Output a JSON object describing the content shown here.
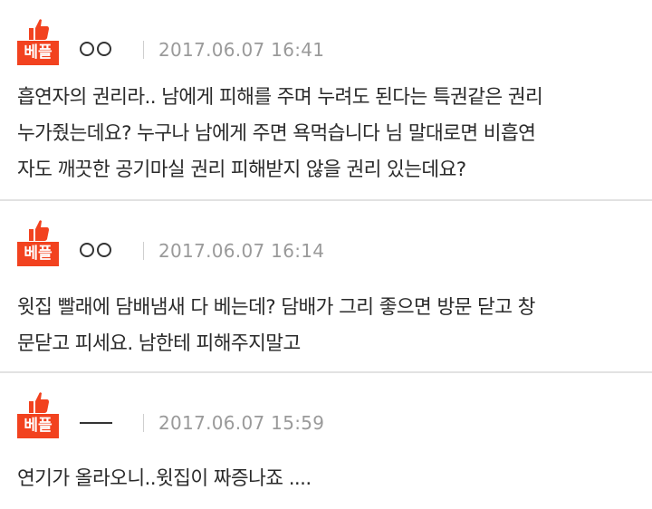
{
  "colors": {
    "badge": "#f2421f",
    "date": "#9a9a9a",
    "divider": "#e2e2e2"
  },
  "comments": [
    {
      "badge": "베플",
      "nickname_style": "circles",
      "date": "2017.06.07 16:41",
      "lines": [
        "흡연자의 권리라.. 남에게 피해를 주며 누려도 된다는 특권같은 권리",
        "누가줬는데요? 누구나 남에게 주면 욕먹습니다 님 말대로면 비흡연",
        "자도 깨끗한 공기마실 권리 피해받지 않을 권리 있는데요?"
      ]
    },
    {
      "badge": "베플",
      "nickname_style": "circles",
      "date": "2017.06.07 16:14",
      "lines": [
        "윗집 빨래에 담배냄새 다 베는데? 담배가 그리 좋으면 방문 닫고 창",
        "문닫고 피세요. 남한테 피해주지말고"
      ]
    },
    {
      "badge": "베플",
      "nickname_style": "dash",
      "date": "2017.06.07 15:59",
      "lines": [
        "연기가 올라오니..윗집이 짜증나죠 ...."
      ]
    }
  ]
}
